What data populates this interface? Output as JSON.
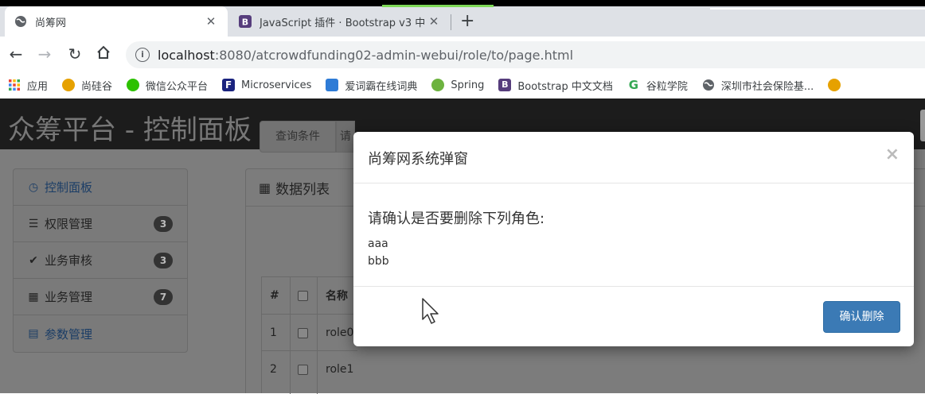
{
  "browser": {
    "tabs": [
      {
        "title": "尚筹网",
        "active": true
      },
      {
        "title": "JavaScript 插件 · Bootstrap v3 中",
        "active": false
      }
    ],
    "url_host": "localhost",
    "url_rest": ":8080/atcrowdfunding02-admin-webui/role/to/page.html",
    "bookmarks": [
      {
        "label": "应用",
        "icon": "apps-grid-icon",
        "color": "#4285f4"
      },
      {
        "label": "尚硅谷",
        "icon": "atguigu-icon",
        "color": "#e6a100"
      },
      {
        "label": "微信公众平台",
        "icon": "wechat-icon",
        "color": "#2dc100"
      },
      {
        "label": "Microservices",
        "icon": "f-logo-icon",
        "color": "#1a237e"
      },
      {
        "label": "爱词霸在线词典",
        "icon": "iciba-icon",
        "color": "#2e7bd6"
      },
      {
        "label": "Spring",
        "icon": "spring-leaf-icon",
        "color": "#6db33f"
      },
      {
        "label": "Bootstrap 中文文档",
        "icon": "bootstrap-icon",
        "color": "#563d7c"
      },
      {
        "label": "谷粒学院",
        "icon": "g-logo-icon",
        "color": "#34a853"
      },
      {
        "label": "深圳市社会保险基...",
        "icon": "globe-icon",
        "color": "#5f6368"
      }
    ]
  },
  "app": {
    "brand": "众筹平台 - 控制面板",
    "sidebar": [
      {
        "label": "控制面板",
        "icon": "dashboard-icon",
        "badge": ""
      },
      {
        "label": "权限管理",
        "icon": "tasks-icon",
        "badge": "3"
      },
      {
        "label": "业务审核",
        "icon": "checkmark-icon",
        "badge": "3"
      },
      {
        "label": "业务管理",
        "icon": "th-large-icon",
        "badge": "7"
      },
      {
        "label": "参数管理",
        "icon": "list-alt-icon",
        "badge": ""
      }
    ],
    "panel_title": "数据列表",
    "query_label": "查询条件",
    "query_next": "请",
    "table": {
      "headers": [
        "#",
        "",
        "名称"
      ],
      "rows": [
        {
          "num": "1",
          "name": "role0"
        },
        {
          "num": "2",
          "name": "role1"
        }
      ]
    }
  },
  "modal": {
    "title": "尚筹网系统弹窗",
    "close": "×",
    "question": "请确认是否要删除下列角色:",
    "roles": [
      "aaa",
      "bbb"
    ],
    "confirm_label": "确认删除"
  },
  "colors": {
    "primary_button": "#3b7ab5",
    "navbar": "#1c1c1c"
  }
}
